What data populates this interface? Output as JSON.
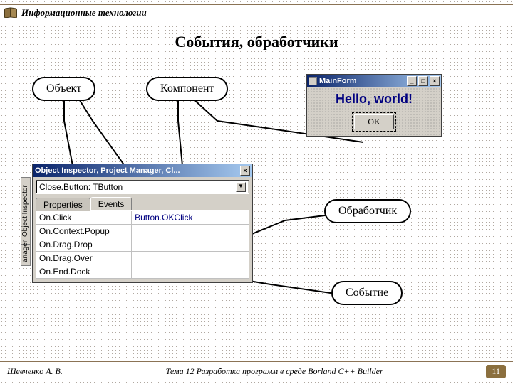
{
  "header": {
    "title": "Информационные технологии"
  },
  "slide": {
    "title": "События, обработчики"
  },
  "bubbles": {
    "object": "Объект",
    "component": "Компонент",
    "handler": "Обработчик",
    "event": "Событие"
  },
  "mainform": {
    "title": "MainForm",
    "hello": "Hello, world!",
    "ok": "OK"
  },
  "inspector": {
    "title": "Object Inspector, Project Manager, Cl...",
    "side_tab_main": "Object Inspector",
    "side_tab_small": "anager",
    "combo": "Close.Button: TButton",
    "tab_props": "Properties",
    "tab_events": "Events",
    "rows": [
      {
        "name": "On.Click",
        "value": "Button.OKClick"
      },
      {
        "name": "On.Context.Popup",
        "value": ""
      },
      {
        "name": "On.Drag.Drop",
        "value": ""
      },
      {
        "name": "On.Drag.Over",
        "value": ""
      },
      {
        "name": "On.End.Dock",
        "value": ""
      }
    ]
  },
  "footer": {
    "author": "Шевченко А. В.",
    "theme": "Тема 12 Разработка программ в среде Borland C++ Builder",
    "page": "11"
  }
}
